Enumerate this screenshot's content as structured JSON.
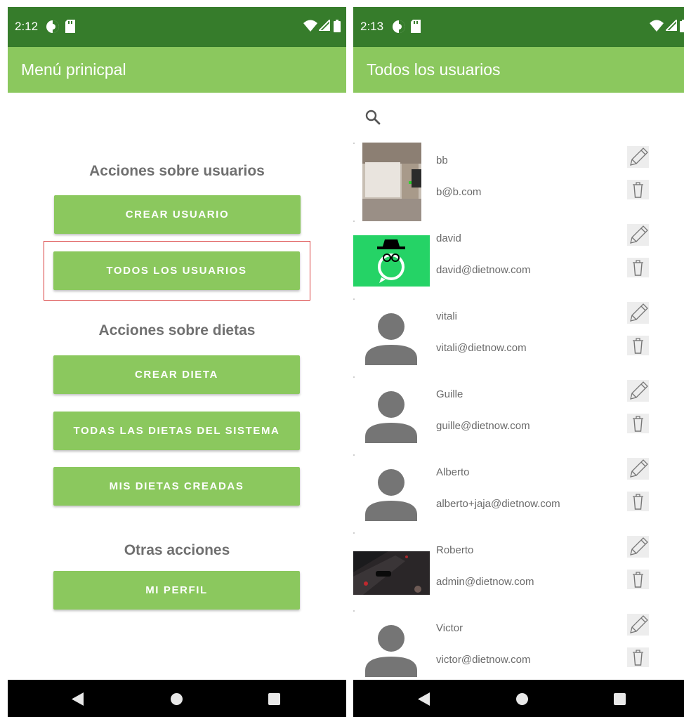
{
  "left_screen": {
    "status": {
      "time": "2:12"
    },
    "appbar": {
      "title": "Menú prinicpal"
    },
    "sections": {
      "users_title": "Acciones sobre usuarios",
      "diets_title": "Acciones sobre dietas",
      "other_title": "Otras acciones"
    },
    "buttons": {
      "create_user": "CREAR USUARIO",
      "all_users": "TODOS LOS USUARIOS",
      "create_diet": "CREAR DIETA",
      "all_diets": "TODAS LAS DIETAS DEL SISTEMA",
      "my_diets": "MIS DIETAS CREADAS",
      "my_profile": "MI PERFIL"
    }
  },
  "right_screen": {
    "status": {
      "time": "2:13"
    },
    "appbar": {
      "title": "Todos los usuarios"
    },
    "users": [
      {
        "name": "bb",
        "email": "b@b.com",
        "avatar": "room-photo"
      },
      {
        "name": "david",
        "email": "david@dietnow.com",
        "avatar": "whatsapp-spy"
      },
      {
        "name": "vitali",
        "email": "vitali@dietnow.com",
        "avatar": "default"
      },
      {
        "name": "Guille",
        "email": "guille@dietnow.com",
        "avatar": "default"
      },
      {
        "name": "Alberto",
        "email": "alberto+jaja@dietnow.com",
        "avatar": "default"
      },
      {
        "name": "Roberto",
        "email": "admin@dietnow.com",
        "avatar": "desk-photo"
      },
      {
        "name": "Victor",
        "email": "victor@dietnow.com",
        "avatar": "default"
      }
    ]
  },
  "colors": {
    "statusbar": "#367c2b",
    "appbar": "#8bc85e",
    "button": "#8bc85e",
    "highlight": "#d83a3a",
    "navbar": "#000000"
  }
}
